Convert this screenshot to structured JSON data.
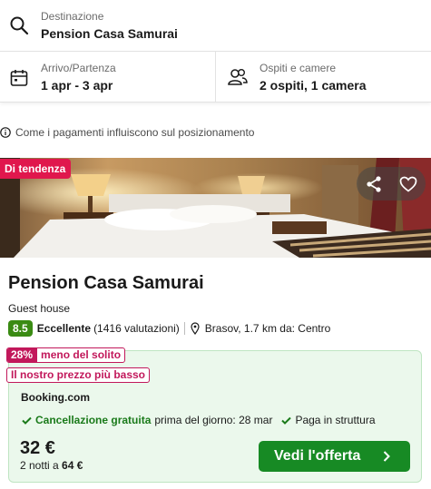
{
  "search": {
    "destination_label": "Destinazione",
    "destination_value": "Pension Casa Samurai",
    "dates_label": "Arrivo/Partenza",
    "dates_value": "1 apr - 3 apr",
    "guests_label": "Ospiti e camere",
    "guests_value": "2 ospiti, 1 camera"
  },
  "info_text": "Come i pagamenti influiscono sul posizionamento",
  "listing": {
    "badge": "Di tendenza",
    "name": "Pension Casa Samurai",
    "type": "Guest house",
    "score": "8.5",
    "rating_word": "Eccellente",
    "rating_count": "(1416 valutazioni)",
    "location": "Brasov, 1.7 km da: Centro"
  },
  "deal": {
    "discount_pct": "28%",
    "discount_text": "meno del solito",
    "best_price_text": "Il nostro prezzo più basso",
    "provider": "Booking.com",
    "perk1_strong": "Cancellazione gratuita",
    "perk1_detail": "prima del giorno: 28 mar",
    "perk2": "Paga in struttura",
    "price": "32 €",
    "nights_prefix": "2 notti a",
    "total": "64 €",
    "cta": "Vedi l'offerta"
  },
  "colors": {
    "trend_badge": "#e0174d",
    "score_bg": "#3a8b13",
    "deal_bg": "#ebf8ec",
    "cta_bg": "#178a24",
    "discount": "#c2185b"
  }
}
